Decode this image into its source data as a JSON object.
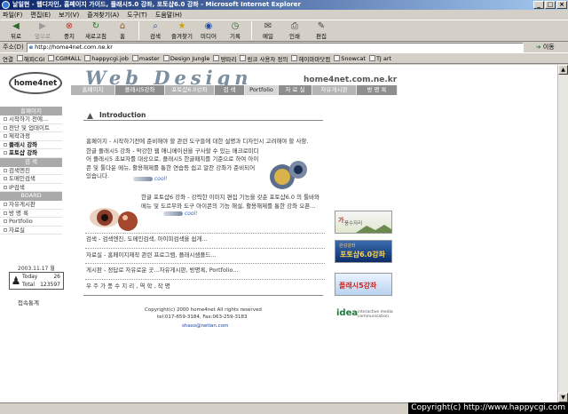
{
  "window": {
    "title": "날일현 - 웹디자인, 홈페이지 가이드, 플래시5.0 강좌, 포토샵6.0 강좌 - Microsoft Internet Explorer",
    "min": "_",
    "max": "□",
    "close": "×"
  },
  "menu": [
    "파일(F)",
    "편집(E)",
    "보기(V)",
    "즐겨찾기(A)",
    "도구(T)",
    "도움말(H)"
  ],
  "toolbar": {
    "back": "뒤로",
    "forward": "앞으로",
    "stop": "중지",
    "refresh": "새로고침",
    "home": "홈",
    "search": "검색",
    "favorites": "즐겨찾기",
    "media": "미디어",
    "history": "기록",
    "mail": "메일",
    "print": "인쇄",
    "edit": "편집"
  },
  "address": {
    "label": "주소(D)",
    "value": "http://home4net.com.ne.kr",
    "go": "이동"
  },
  "links": {
    "label": "연결",
    "items": [
      "해피CGI",
      "CGIMALL",
      "happycgi.job",
      "master",
      "Design Jungle",
      "땅따리",
      "링크 사용자 정의",
      "헤이마마닷컴",
      "Snowcat",
      "TJ art"
    ]
  },
  "site": {
    "logo": "home4net",
    "title": "Web Design",
    "domain": "home4net.com.ne.kr",
    "nav": [
      "홈페이지",
      "플래시5강좌",
      "포토샵6.0강좌",
      "검 색",
      "Portfolio",
      "자 료 실",
      "자유게시판",
      "방 명 록"
    ]
  },
  "sidebar": {
    "header": "홈페이지",
    "items": [
      "시작하기 전에...",
      "전단 및 업데이트",
      "제작과정",
      "플래시 강좌",
      "포토샵 강좌"
    ],
    "search_header": "검 색",
    "search_items": [
      "검색엔진",
      "도메인검색",
      "IP검색"
    ],
    "board_header": "BOARD",
    "board_items": [
      "자유게시판",
      "방 명 록",
      "Portfolio",
      "자료실"
    ]
  },
  "counter": {
    "date": "2003.11.17 월",
    "today_label": "Today",
    "today_value": "26",
    "total_label": "Total",
    "total_value": "123597",
    "stats_link": "접속통계"
  },
  "main": {
    "section_title": "Introduction",
    "p1": "홈페이지 - 시작하기전에 준비해야 할 관련 도구들에 대한 설명과 디자인시 고려해야 할 사항.",
    "p1b": "한글 플래시5 강좌 - 막강한 웹 애니메이션을 구사할 수 있는 매크로미디어 플래시5 초보자를 대상으로, 플래시5 한글패치를 기준으로 하여 아이콘 및 툴다운 메뉴, 활용해제를 통한 연습등 쉽고 알찬 강좌가 준비되어 있습니다.",
    "more1": "cool!",
    "p2": "한글 포토샵6 강좌 - 강력한 이미지 편집 기능을 갖춘 포토샵6.0 의 툴바와 메뉴 및 도르무와 도구 아이콘의 기능 해설, 활용해제를 통한 강좌 오픈...",
    "more2": "cool!",
    "p3": "검색 - 검색엔진, 도메인검색, 아이피검색을 쉽게...",
    "p4": "자료실 - 홈페이지제작 관련 프로그램, 플래시샘플드...",
    "p5": "게시판 - 정답로 자유로운 곳...자유게시판, 방명록, Portfolio...",
    "p6": "우 주 가 풍 수 지 리 , 역 학 , 작 명"
  },
  "footer": {
    "copyright": "Copyright(c) 2000 home4net All rights reserved",
    "tel": "tel:017-659-3184, Fax:063-259-3183",
    "email": "shaso@netian.com"
  },
  "banners": {
    "b1_title": "가",
    "b1_sub": "풍수자리",
    "b2_sub": "완성강좌",
    "b2_title": "포토샵6.0강좌",
    "b3_title": "플래시5강좌",
    "b4_title": "idea",
    "b4_sub": "interactive media communication"
  },
  "watermark": "Copyright(c) http://www.happycgi.com"
}
